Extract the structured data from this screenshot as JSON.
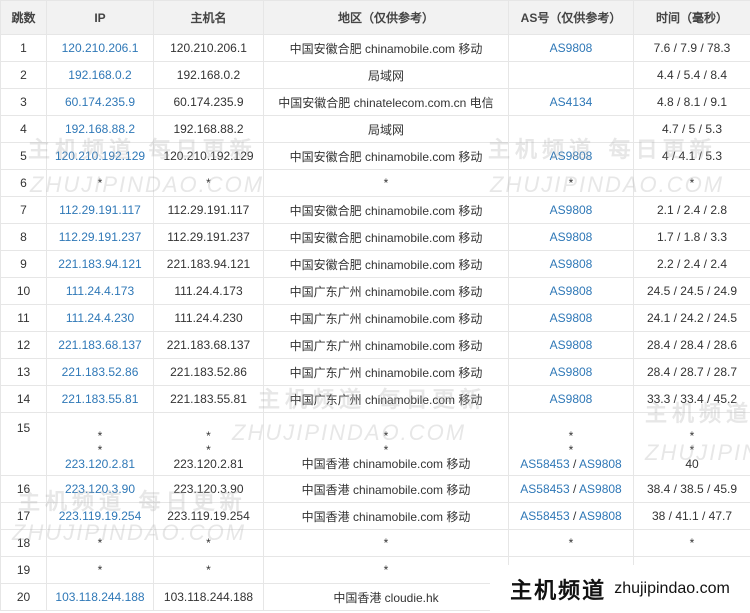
{
  "headers": [
    "跳数",
    "IP",
    "主机名",
    "地区（仅供参考）",
    "AS号（仅供参考）",
    "时间（毫秒）"
  ],
  "rows": [
    {
      "hop": "1",
      "ip": "120.210.206.1",
      "host": "120.210.206.1",
      "region": "中国安徽合肥 chinamobile.com 移动",
      "as": [
        "AS9808"
      ],
      "time": "7.6 / 7.9 / 78.3"
    },
    {
      "hop": "2",
      "ip": "192.168.0.2",
      "host": "192.168.0.2",
      "region": "局域网",
      "as": [],
      "time": "4.4 / 5.4 / 8.4"
    },
    {
      "hop": "3",
      "ip": "60.174.235.9",
      "host": "60.174.235.9",
      "region": "中国安徽合肥 chinatelecom.com.cn 电信",
      "as": [
        "AS4134"
      ],
      "time": "4.8 / 8.1 / 9.1"
    },
    {
      "hop": "4",
      "ip": "192.168.88.2",
      "host": "192.168.88.2",
      "region": "局域网",
      "as": [],
      "time": "4.7 / 5 / 5.3"
    },
    {
      "hop": "5",
      "ip": "120.210.192.129",
      "host": "120.210.192.129",
      "region": "中国安徽合肥 chinamobile.com 移动",
      "as": [
        "AS9808"
      ],
      "time": "4 / 4.1 / 5.3"
    },
    {
      "hop": "6",
      "ip": "*",
      "host": "*",
      "region": "*",
      "as_text": "*",
      "time": "*"
    },
    {
      "hop": "7",
      "ip": "112.29.191.117",
      "host": "112.29.191.117",
      "region": "中国安徽合肥 chinamobile.com 移动",
      "as": [
        "AS9808"
      ],
      "time": "2.1 / 2.4 / 2.8"
    },
    {
      "hop": "8",
      "ip": "112.29.191.237",
      "host": "112.29.191.237",
      "region": "中国安徽合肥 chinamobile.com 移动",
      "as": [
        "AS9808"
      ],
      "time": "1.7 / 1.8 / 3.3"
    },
    {
      "hop": "9",
      "ip": "221.183.94.121",
      "host": "221.183.94.121",
      "region": "中国安徽合肥 chinamobile.com 移动",
      "as": [
        "AS9808"
      ],
      "time": "2.2 / 2.4 / 2.4"
    },
    {
      "hop": "10",
      "ip": "111.24.4.173",
      "host": "111.24.4.173",
      "region": "中国广东广州 chinamobile.com 移动",
      "as": [
        "AS9808"
      ],
      "time": "24.5 / 24.5 / 24.9"
    },
    {
      "hop": "11",
      "ip": "111.24.4.230",
      "host": "111.24.4.230",
      "region": "中国广东广州 chinamobile.com 移动",
      "as": [
        "AS9808"
      ],
      "time": "24.1 / 24.2 / 24.5"
    },
    {
      "hop": "12",
      "ip": "221.183.68.137",
      "host": "221.183.68.137",
      "region": "中国广东广州 chinamobile.com 移动",
      "as": [
        "AS9808"
      ],
      "time": "28.4 / 28.4 / 28.6"
    },
    {
      "hop": "13",
      "ip": "221.183.52.86",
      "host": "221.183.52.86",
      "region": "中国广东广州 chinamobile.com 移动",
      "as": [
        "AS9808"
      ],
      "time": "28.4 / 28.7 / 28.7"
    },
    {
      "hop": "14",
      "ip": "221.183.55.81",
      "host": "221.183.55.81",
      "region": "中国广东广州 chinamobile.com 移动",
      "as": [
        "AS9808"
      ],
      "time": "33.3 / 33.4 / 45.2"
    },
    {
      "hop": "15",
      "multi": true,
      "stars": [
        "*",
        "*"
      ],
      "ip": "223.120.2.81",
      "host": "223.120.2.81",
      "region": "中国香港 chinamobile.com 移动",
      "as": [
        "AS58453",
        "AS9808"
      ],
      "time": "40"
    },
    {
      "hop": "16",
      "ip": "223.120.3.90",
      "host": "223.120.3.90",
      "region": "中国香港 chinamobile.com 移动",
      "as": [
        "AS58453",
        "AS9808"
      ],
      "time": "38.4 / 38.5 / 45.9"
    },
    {
      "hop": "17",
      "ip": "223.119.19.254",
      "host": "223.119.19.254",
      "region": "中国香港 chinamobile.com 移动",
      "as": [
        "AS58453",
        "AS9808"
      ],
      "time": "38 / 41.1 / 47.7"
    },
    {
      "hop": "18",
      "ip": "*",
      "host": "*",
      "region": "*",
      "as_text": "*",
      "time": "*"
    },
    {
      "hop": "19",
      "ip": "*",
      "host": "*",
      "region": "*",
      "as_text": "*",
      "time": "*"
    },
    {
      "hop": "20",
      "ip": "103.118.244.188",
      "host": "103.118.244.188",
      "region": "中国香港 cloudie.hk",
      "as": [],
      "time": ""
    }
  ],
  "watermarks": [
    {
      "cn": "主机频道 每日更新",
      "en": "ZHUJIPINDAO.COM"
    },
    {
      "cn": "主机频道 每日更新",
      "en": "ZHUJIPINDAO.COM"
    },
    {
      "cn": "主机频道 每日更新",
      "en": "ZHUJIPINDAO.COM"
    },
    {
      "cn": "主机频道 每日更新",
      "en": "ZHUJIPINDAO.COM"
    },
    {
      "cn": "主机频道",
      "en": "ZHUJIPIND"
    }
  ],
  "brand": {
    "cn": "主机频道",
    "en": "zhujipindao.com"
  },
  "colors": {
    "link": "#2f78b7",
    "header_bg": "#f2f2f2",
    "border": "#e6e6e6"
  }
}
